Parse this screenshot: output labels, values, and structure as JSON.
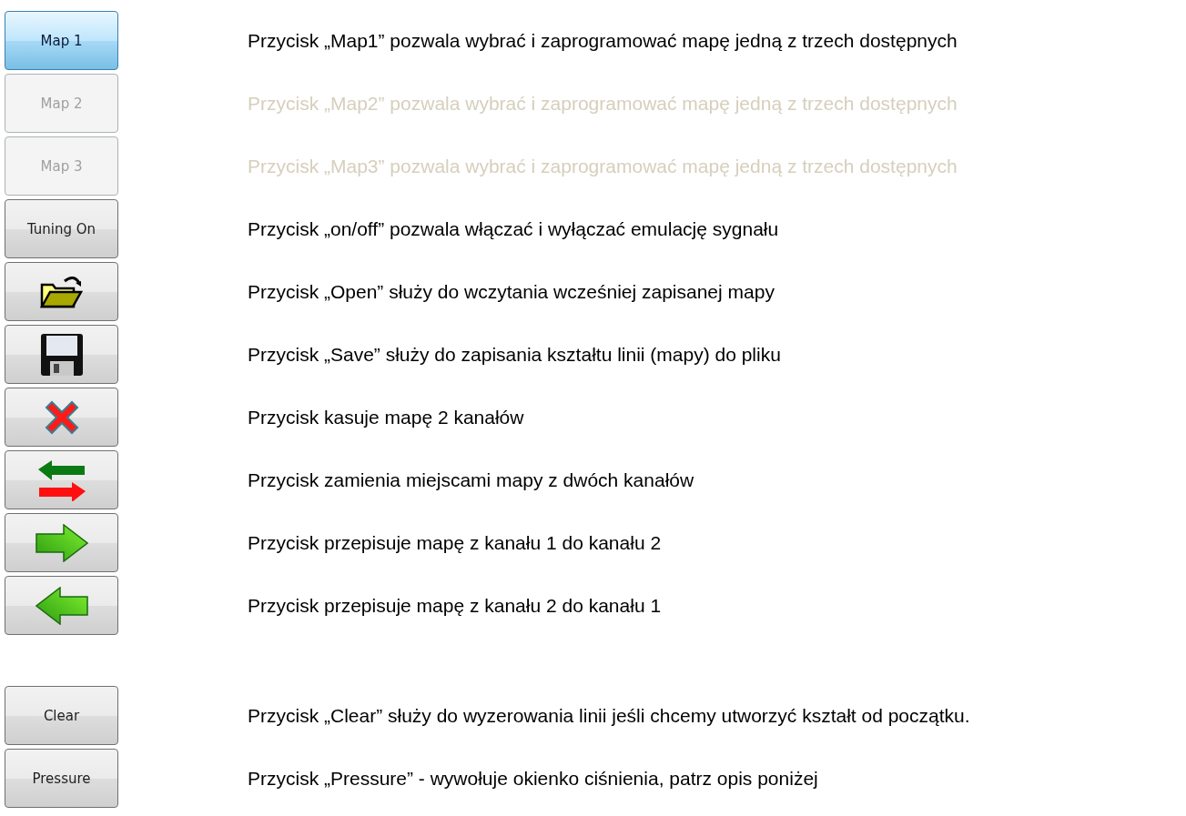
{
  "groups": [
    {
      "items": [
        {
          "kind": "text",
          "label": "Map 1",
          "selected": true,
          "disabled": false,
          "description": "Przycisk „Map1” pozwala wybrać i zaprogramować mapę jedną z trzech dostępnych"
        },
        {
          "kind": "text",
          "label": "Map 2",
          "selected": false,
          "disabled": true,
          "description": "Przycisk „Map2” pozwala wybrać i zaprogramować mapę jedną z trzech dostępnych"
        },
        {
          "kind": "text",
          "label": "Map 3",
          "selected": false,
          "disabled": true,
          "description": "Przycisk „Map3” pozwala wybrać i zaprogramować mapę jedną z trzech dostępnych"
        },
        {
          "kind": "text",
          "label": "Tuning On",
          "selected": false,
          "disabled": false,
          "description": "Przycisk „on/off” pozwala włączać i wyłączać emulację sygnału"
        },
        {
          "kind": "open",
          "disabled": false,
          "description": "Przycisk „Open” służy do wczytania wcześniej zapisanej mapy"
        },
        {
          "kind": "save",
          "disabled": false,
          "description": "Przycisk „Save” służy do zapisania kształtu linii (mapy) do pliku"
        },
        {
          "kind": "delete",
          "disabled": false,
          "description": "Przycisk kasuje mapę 2 kanałów"
        },
        {
          "kind": "swap",
          "disabled": false,
          "description": "Przycisk zamienia miejscami mapy z dwóch kanałów"
        },
        {
          "kind": "right",
          "disabled": false,
          "description": "Przycisk przepisuje mapę z kanału 1 do kanału 2"
        },
        {
          "kind": "left",
          "disabled": false,
          "description": "Przycisk przepisuje mapę z kanału 2 do kanału 1"
        }
      ]
    },
    {
      "items": [
        {
          "kind": "text",
          "label": "Clear",
          "selected": false,
          "disabled": false,
          "description": "Przycisk „Clear” służy do wyzerowania linii jeśli chcemy utworzyć kształt od początku."
        },
        {
          "kind": "text",
          "label": "Pressure",
          "selected": false,
          "disabled": false,
          "description": "Przycisk „Pressure”  - wywołuje okienko ciśnienia,  patrz opis poniżej"
        }
      ]
    }
  ]
}
